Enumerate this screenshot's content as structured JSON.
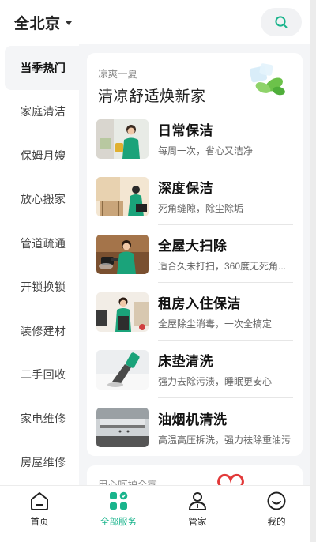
{
  "header": {
    "city": "全北京"
  },
  "sidebar": {
    "items": [
      {
        "label": "当季热门",
        "active": true
      },
      {
        "label": "家庭清洁"
      },
      {
        "label": "保姆月嫂"
      },
      {
        "label": "放心搬家"
      },
      {
        "label": "管道疏通"
      },
      {
        "label": "开锁换锁"
      },
      {
        "label": "装修建材"
      },
      {
        "label": "二手回收"
      },
      {
        "label": "家电维修"
      },
      {
        "label": "房屋维修"
      }
    ]
  },
  "banner": {
    "subtitle": "凉爽一夏",
    "title": "清凉舒适焕新家"
  },
  "services": [
    {
      "name": "日常保洁",
      "desc": "每周一次，省心又洁净"
    },
    {
      "name": "深度保洁",
      "desc": "死角缝隙，除尘除垢"
    },
    {
      "name": "全屋大扫除",
      "desc": "适合久未打扫，360度无死角..."
    },
    {
      "name": "租房入住保洁",
      "desc": "全屋除尘消毒，一次全搞定"
    },
    {
      "name": "床垫清洗",
      "desc": "强力去除污渍，睡眠更安心"
    },
    {
      "name": "油烟机清洗",
      "desc": "高温高压拆洗，强力祛除重油污"
    }
  ],
  "card2": {
    "subtitle": "用心呵护全家"
  },
  "tabbar": {
    "items": [
      {
        "label": "首页"
      },
      {
        "label": "全部服务",
        "active": true
      },
      {
        "label": "管家"
      },
      {
        "label": "我的"
      }
    ]
  },
  "colors": {
    "accent": "#19b48c",
    "background": "#f4f5f7"
  }
}
